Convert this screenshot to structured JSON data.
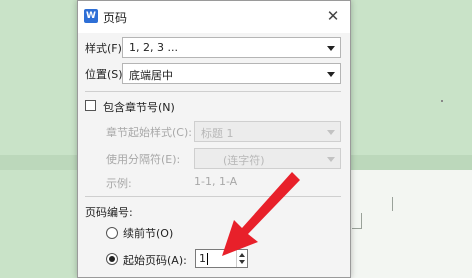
{
  "dialog": {
    "title": "页码",
    "icon_label": "W",
    "close_symbol": "✕",
    "style": {
      "label": "样式(F):",
      "value": "1, 2, 3 ..."
    },
    "position": {
      "label": "位置(S):",
      "value": "底端居中"
    },
    "include_chapter": {
      "label": "包含章节号(N)",
      "checked": false
    },
    "chapter_start_style": {
      "label": "章节起始样式(C):",
      "value": "标题 1"
    },
    "separator": {
      "label": "使用分隔符(E):",
      "value": "(连字符)"
    },
    "example": {
      "label": "示例:",
      "value": "1-1, 1-A"
    },
    "numbering": {
      "section_label": "页码编号:",
      "continue_label": "续前节(O)",
      "start_label": "起始页码(A):",
      "start_value": "1",
      "selected": "start"
    }
  },
  "colors": {
    "background": "#c9e3c8",
    "arrow": "#e8202a",
    "accent": "#2e6fd6"
  }
}
